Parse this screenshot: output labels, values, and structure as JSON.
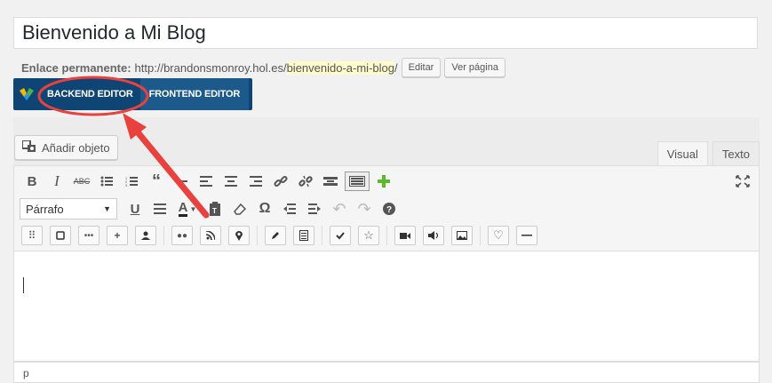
{
  "post": {
    "title": "Bienvenido a Mi Blog",
    "permalink_label": "Enlace permanente:",
    "permalink_base": "http://brandonsmonroy.hol.es/",
    "permalink_slug": "bienvenido-a-mi-blog",
    "permalink_tail": "/",
    "edit_button": "Editar",
    "view_button": "Ver página"
  },
  "composer": {
    "backend": "BACKEND EDITOR",
    "frontend": "FRONTEND EDITOR"
  },
  "media": {
    "add_media": "Añadir objeto"
  },
  "tabs": {
    "visual": "Visual",
    "text": "Texto"
  },
  "toolbar": {
    "format": "Párrafo"
  },
  "statusbar": {
    "path": "p"
  },
  "colors": {
    "composer_bar": "#0f4574",
    "annotation": "#e8413e",
    "slug_highlight": "#fffbcc"
  }
}
